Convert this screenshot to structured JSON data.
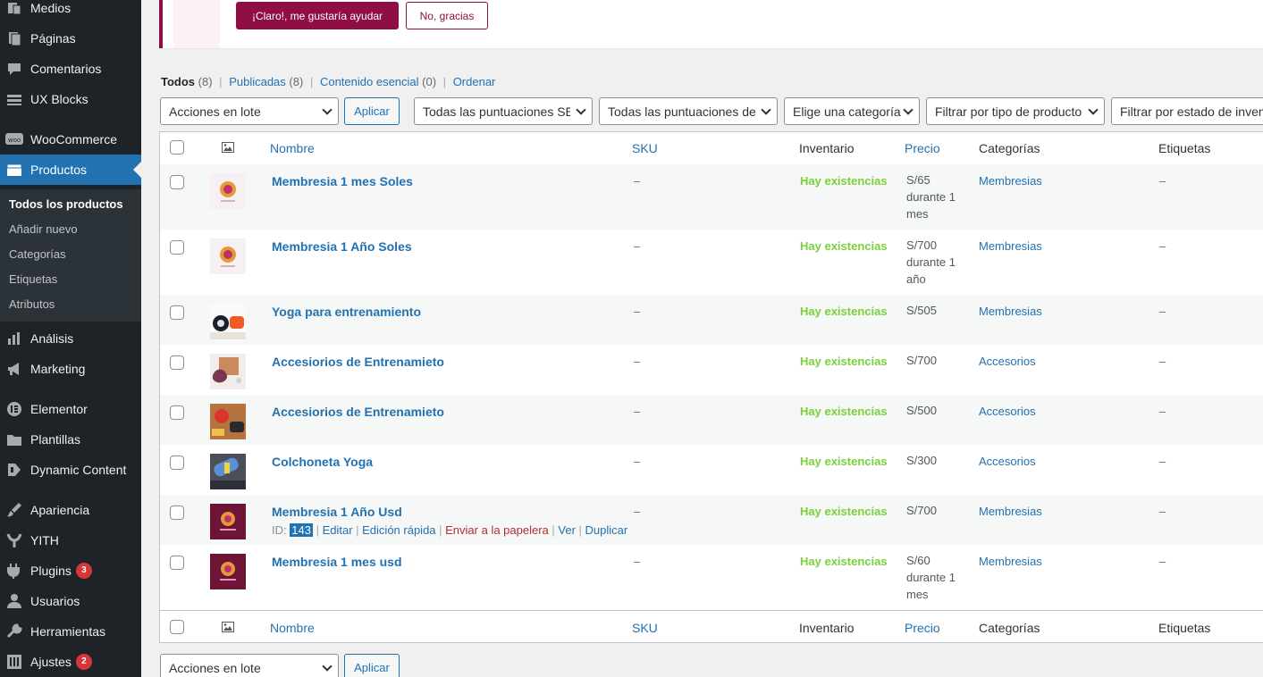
{
  "sidebar": {
    "items": [
      {
        "label": "Medios",
        "icon": "media-icon"
      },
      {
        "label": "Páginas",
        "icon": "pages-icon"
      },
      {
        "label": "Comentarios",
        "icon": "comments-icon"
      },
      {
        "label": "UX Blocks",
        "icon": "ux-blocks-icon"
      },
      {
        "label": "WooCommerce",
        "icon": "woocommerce-icon"
      },
      {
        "label": "Productos",
        "icon": "products-icon"
      },
      {
        "label": "Análisis",
        "icon": "analytics-icon"
      },
      {
        "label": "Marketing",
        "icon": "marketing-icon"
      },
      {
        "label": "Elementor",
        "icon": "elementor-icon"
      },
      {
        "label": "Plantillas",
        "icon": "templates-icon"
      },
      {
        "label": "Dynamic Content",
        "icon": "dynamic-content-icon"
      },
      {
        "label": "Apariencia",
        "icon": "appearance-icon"
      },
      {
        "label": "YITH",
        "icon": "yith-icon"
      },
      {
        "label": "Plugins",
        "icon": "plugins-icon",
        "badge": "3"
      },
      {
        "label": "Usuarios",
        "icon": "users-icon"
      },
      {
        "label": "Herramientas",
        "icon": "tools-icon"
      },
      {
        "label": "Ajustes",
        "icon": "settings-icon",
        "badge": "2"
      }
    ],
    "submenu": [
      "Todos los productos",
      "Añadir nuevo",
      "Categorías",
      "Etiquetas",
      "Atributos"
    ]
  },
  "notice": {
    "primary_label": "¡Claro!, me gustaría ayudar",
    "secondary_label": "No, gracias"
  },
  "views": {
    "all": "Todos",
    "all_count": "(8)",
    "published": "Publicadas",
    "published_count": "(8)",
    "cornerstone": "Contenido esencial",
    "cornerstone_count": "(0)",
    "sort": "Ordenar"
  },
  "filters": {
    "bulk_action": "Acciones en lote",
    "apply": "Aplicar",
    "seo_scores": "Todas las puntuaciones SEO",
    "readability_scores": "Todas las puntuaciones de legibilidad",
    "category": "Elige una categoría",
    "product_type": "Filtrar por tipo de producto",
    "stock_status": "Filtrar por estado de inventario"
  },
  "columns": {
    "name": "Nombre",
    "sku": "SKU",
    "stock": "Inventario",
    "price": "Precio",
    "categories": "Categorías",
    "tags": "Etiquetas"
  },
  "products": [
    {
      "name": "Membresia 1 mes Soles",
      "sku": "–",
      "stock": "Hay existencias",
      "price": "S/65 durante 1 mes",
      "category": "Membresias",
      "tags": "–"
    },
    {
      "name": "Membresia 1 Año Soles",
      "sku": "–",
      "stock": "Hay existencias",
      "price": "S/700 durante 1 año",
      "category": "Membresias",
      "tags": "–"
    },
    {
      "name": "Yoga para entrenamiento",
      "sku": "–",
      "stock": "Hay existencias",
      "price": "S/505",
      "category": "Membresias",
      "tags": "–"
    },
    {
      "name": "Accesiorios de Entrenamieto",
      "sku": "–",
      "stock": "Hay existencias",
      "price": "S/700",
      "category": "Accesorios",
      "tags": "–"
    },
    {
      "name": "Accesiorios de Entrenamieto",
      "sku": "–",
      "stock": "Hay existencias",
      "price": "S/500",
      "category": "Accesorios",
      "tags": "–"
    },
    {
      "name": "Colchoneta Yoga",
      "sku": "–",
      "stock": "Hay existencias",
      "price": "S/300",
      "category": "Accesorios",
      "tags": "–"
    },
    {
      "name": "Membresia 1 Año Usd",
      "sku": "–",
      "stock": "Hay existencias",
      "price": "S/700",
      "category": "Membresias",
      "tags": "–"
    },
    {
      "name": "Membresia 1 mes usd",
      "sku": "–",
      "stock": "Hay existencias",
      "price": "S/60 durante 1 mes",
      "category": "Membresias",
      "tags": "–"
    }
  ],
  "row_actions": {
    "id_label": "ID:",
    "id_value": "143",
    "edit": "Editar",
    "quick_edit": "Edición rápida",
    "trash": "Enviar a la papelera",
    "view": "Ver",
    "duplicate": "Duplicar"
  },
  "colors": {
    "accent": "#2271b1",
    "sidebar_bg": "#1d2327",
    "in_stock": "#7ad03a",
    "brand": "#8e0e45",
    "trash": "#b32d2e"
  }
}
